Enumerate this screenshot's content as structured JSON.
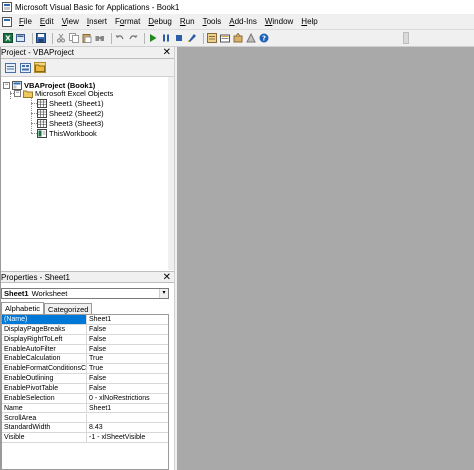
{
  "window": {
    "title": "Microsoft Visual Basic for Applications - Book1"
  },
  "menubar": {
    "items": [
      {
        "label": "File",
        "underline_index": 0
      },
      {
        "label": "Edit",
        "underline_index": 0
      },
      {
        "label": "View",
        "underline_index": 0
      },
      {
        "label": "Insert",
        "underline_index": 0
      },
      {
        "label": "Format",
        "underline_index": 1
      },
      {
        "label": "Debug",
        "underline_index": 0
      },
      {
        "label": "Run",
        "underline_index": 0
      },
      {
        "label": "Tools",
        "underline_index": 0
      },
      {
        "label": "Add-Ins",
        "underline_index": 0
      },
      {
        "label": "Window",
        "underline_index": 0
      },
      {
        "label": "Help",
        "underline_index": 0
      }
    ]
  },
  "toolbar": {
    "icons": [
      "excel-icon",
      "insert-module-icon",
      "save-icon",
      "cut-icon",
      "copy-icon",
      "paste-icon",
      "find-icon",
      "undo-icon",
      "redo-icon",
      "run-icon",
      "break-icon",
      "reset-icon",
      "design-mode-icon",
      "project-explorer-icon",
      "properties-window-icon",
      "object-browser-icon",
      "toolbox-icon",
      "help-icon"
    ]
  },
  "project_panel": {
    "title": "Project - VBAProject",
    "close_glyph": "✕",
    "tree": {
      "root": "VBAProject (Book1)",
      "folder": "Microsoft Excel Objects",
      "items": [
        "Sheet1 (Sheet1)",
        "Sheet2 (Sheet2)",
        "Sheet3 (Sheet3)",
        "ThisWorkbook"
      ]
    }
  },
  "properties_panel": {
    "title": "Properties - Sheet1",
    "close_glyph": "✕",
    "object_name": "Sheet1",
    "object_type": "Worksheet",
    "dropdown_glyph": "▾",
    "tabs": [
      "Alphabetic",
      "Categorized"
    ],
    "rows": [
      {
        "name": "(Name)",
        "value": "Sheet1"
      },
      {
        "name": "DisplayPageBreaks",
        "value": "False"
      },
      {
        "name": "DisplayRightToLeft",
        "value": "False"
      },
      {
        "name": "EnableAutoFilter",
        "value": "False"
      },
      {
        "name": "EnableCalculation",
        "value": "True"
      },
      {
        "name": "EnableFormatConditionsCalc",
        "value": "True"
      },
      {
        "name": "EnableOutlining",
        "value": "False"
      },
      {
        "name": "EnablePivotTable",
        "value": "False"
      },
      {
        "name": "EnableSelection",
        "value": "0 - xlNoRestrictions"
      },
      {
        "name": "Name",
        "value": "Sheet1"
      },
      {
        "name": "ScrollArea",
        "value": ""
      },
      {
        "name": "StandardWidth",
        "value": "8.43"
      },
      {
        "name": "Visible",
        "value": "-1 - xlSheetVisible"
      }
    ]
  },
  "colors": {
    "workspace": "#a9a9a9",
    "selection": "#0078d7",
    "chrome": "#f0f0f0"
  }
}
